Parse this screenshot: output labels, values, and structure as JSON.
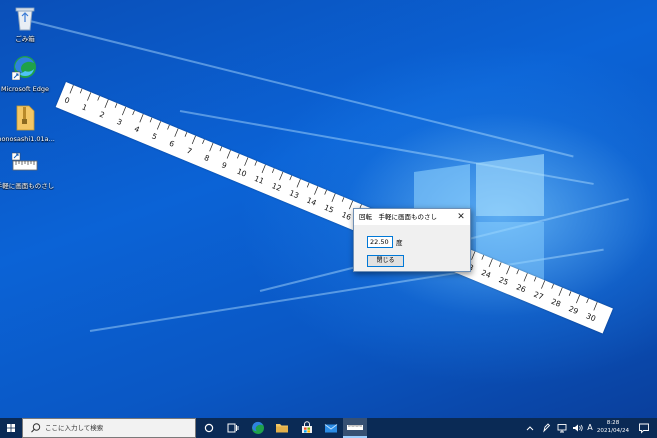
{
  "desktop": {
    "icons": [
      {
        "label": "ごみ箱",
        "icon": "recycle-bin-icon"
      },
      {
        "label": "Microsoft Edge",
        "icon": "edge-icon"
      },
      {
        "label": "monosashi1.01a...",
        "icon": "zip-folder-icon"
      },
      {
        "label": "手軽に画面ものさし",
        "icon": "ruler-app-icon"
      }
    ]
  },
  "ruler": {
    "ticks": [
      "0",
      "1",
      "2",
      "3",
      "4",
      "5",
      "6",
      "7",
      "8",
      "9",
      "10",
      "11",
      "12",
      "13",
      "14",
      "15",
      "16",
      "17",
      "18",
      "19",
      "20",
      "21",
      "22",
      "23",
      "24",
      "25",
      "26",
      "27",
      "28",
      "29",
      "30"
    ],
    "rotation_deg": 22.5
  },
  "dialog": {
    "title": "回転　手軽に画面ものさし",
    "angle_value": "22.50",
    "unit": "度",
    "close_button": "閉じる"
  },
  "taskbar": {
    "search_placeholder": "ここに入力して検索",
    "tray_ime": "A",
    "clock_time": "8:28",
    "clock_date": "2021/04/24"
  },
  "colors": {
    "accent": "#0078d7",
    "taskbar": "#0a2a55",
    "wallpaper": "#0b5cc9"
  }
}
